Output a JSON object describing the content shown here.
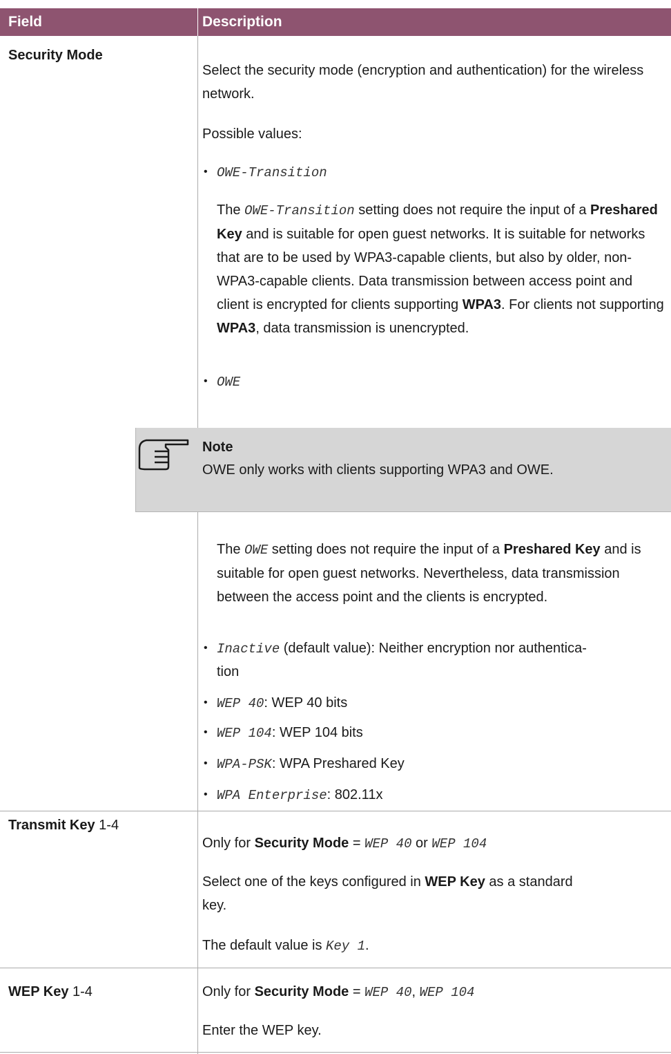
{
  "header": {
    "field": "Field",
    "description": "Description"
  },
  "rows": {
    "security_mode": {
      "field": "Security Mode",
      "intro": "Select the security mode (encryption and authentication) for the wireless network.",
      "possible_values": "Possible values:",
      "owe_transition": {
        "value": "OWE-Transition",
        "desc_1": "The ",
        "desc_code": "OWE-Transition",
        "desc_2": " setting does not require the input of a ",
        "desc_bold1": "Preshared Key",
        "desc_3": " and is suitable for open guest networks. It is suitable for networks that are to be used by WPA3-capable clients, but also by older, non-WPA3-capable clients. Data transmission between access point and client is encrypted for clients supporting ",
        "desc_bold2": "WPA3",
        "desc_4": ". For clients not supporting ",
        "desc_bold3": "WPA3",
        "desc_5": ", data transmission is unencrypted."
      },
      "owe": {
        "value": "OWE",
        "desc_1": "The ",
        "desc_code": "OWE",
        "desc_2": " setting does not require the input of a ",
        "desc_bold1": "Preshared Key",
        "desc_3": " and is suitable for open guest networks. Nevertheless, data transmission between the access point and the clients is encrypted."
      },
      "note": {
        "title": "Note",
        "text": "OWE only works with clients supporting WPA3 and OWE."
      },
      "values": [
        {
          "code": "Inactive",
          "text": " (default value): Neither encryption nor authentica-",
          "cont": "tion"
        },
        {
          "code": "WEP 40",
          "text": ": WEP 40 bits"
        },
        {
          "code": "WEP 104",
          "text": ": WEP 104 bits"
        },
        {
          "code": "WPA-PSK",
          "text": ": WPA Preshared Key"
        },
        {
          "code": "WPA Enterprise",
          "text": ": 802.11x"
        }
      ]
    },
    "transmit_key": {
      "field_bold": "Transmit Key",
      "field_rest": " 1-4",
      "only_for_1": "Only for ",
      "only_for_bold": "Security Mode",
      "only_for_2": " = ",
      "only_for_code1": "WEP 40",
      "only_for_3": " or ",
      "only_for_code2": "WEP 104",
      "select_1": "Select one of the keys configured in ",
      "select_bold": "WEP Key",
      "select_2": " as a standard",
      "select_3": "key.",
      "default_1": "The default value is ",
      "default_code": "Key 1",
      "default_2": "."
    },
    "wep_key": {
      "field_bold": "WEP Key",
      "field_rest": " 1-4",
      "only_for_1": "Only for ",
      "only_for_bold": "Security Mode",
      "only_for_2": " = ",
      "only_for_code1": "WEP 40",
      "only_for_3": ", ",
      "only_for_code2": "WEP 104",
      "enter": "Enter the WEP key."
    }
  },
  "colors": {
    "header_bg": "#8e5470",
    "note_bg": "#d6d6d6",
    "rule": "#aaaaaa"
  },
  "icons": {
    "note": "pointing-hand-icon"
  }
}
